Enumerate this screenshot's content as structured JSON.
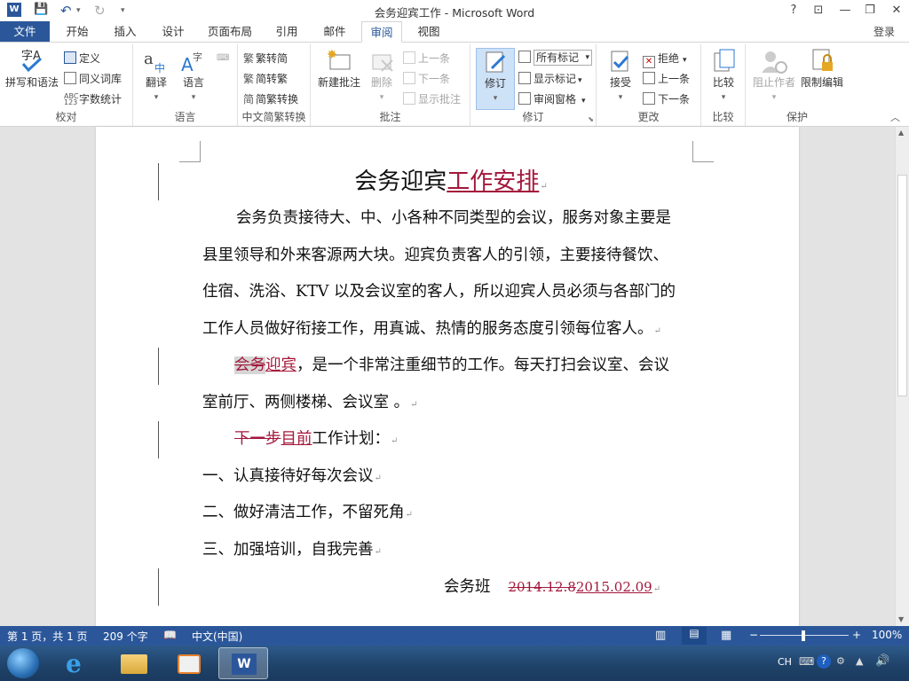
{
  "window": {
    "title": "会务迎宾工作 - Microsoft Word",
    "controls": {
      "help": "?",
      "restore_ribbon": "⊡",
      "minimize": "—",
      "restore": "❐",
      "close": "✕"
    }
  },
  "tabs": [
    "文件",
    "开始",
    "插入",
    "设计",
    "页面布局",
    "引用",
    "邮件",
    "审阅",
    "视图"
  ],
  "active_tab": "审阅",
  "login": "登录",
  "ribbon": {
    "proofing": {
      "label": "校对",
      "spelling": "拼写和语法",
      "define": "定义",
      "thesaurus": "同义词库",
      "word_count": "字数统计"
    },
    "language": {
      "label": "语言",
      "translate": "翻译",
      "language": "语言"
    },
    "chinese_conv": {
      "label": "中文简繁转换",
      "to_simplified": "繁转简",
      "to_traditional": "简转繁",
      "conversion": "简繁转换"
    },
    "comments": {
      "label": "批注",
      "new": "新建批注",
      "delete": "删除",
      "prev": "上一条",
      "next": "下一条",
      "show": "显示批注"
    },
    "tracking": {
      "label": "修订",
      "track": "修订",
      "markup_select": "所有标记",
      "show_markup": "显示标记",
      "reviewing_pane": "审阅窗格"
    },
    "changes": {
      "label": "更改",
      "accept": "接受",
      "reject": "拒绝",
      "prev": "上一条",
      "next": "下一条"
    },
    "compare": {
      "label": "比较",
      "compare": "比较"
    },
    "protect": {
      "label": "保护",
      "block_authors": "阻止作者",
      "restrict": "限制编辑"
    }
  },
  "document": {
    "title_plain": "会务迎宾",
    "title_inserted": "工作安排",
    "p1_lines": [
      "会务负责接待大、中、小各种不同类型的会议，服务对象主要是",
      "县里领导和外来客源两大块。迎宾负责客人的引领，主要接待餐饮、",
      "住宿、洗浴、KTV 以及会议室的客人，所以迎宾人员必须与各部门的",
      "工作人员做好衔接工作，用真诚、热情的服务态度引领每位客人。"
    ],
    "p2_deleted": "会务",
    "p2_inserted": "迎宾",
    "p2_rest": "，是一个非常注重细节的工作。每天打扫会议室、会议",
    "p2_line2": "室前厅、两侧楼梯、会议室 。",
    "p3_deleted": "下一步",
    "p3_inserted": "目前",
    "p3_rest": "工作计划：",
    "list": [
      "一、认真接待好每次会议",
      "二、做好清洁工作，不留死角",
      "三、加强培训，自我完善"
    ],
    "sign_team": "会务班",
    "date_deleted": "2014.12.8",
    "date_inserted": "2015.02.09"
  },
  "status": {
    "page": "第 1 页，共 1 页",
    "words": "209 个字",
    "lang": "中文(中国)",
    "zoom": "100%",
    "zoom_minus": "−",
    "zoom_plus": "+"
  },
  "tray": {
    "ime": "CH"
  },
  "colors": {
    "accent": "#2b579a",
    "revision": "#a3173b"
  }
}
